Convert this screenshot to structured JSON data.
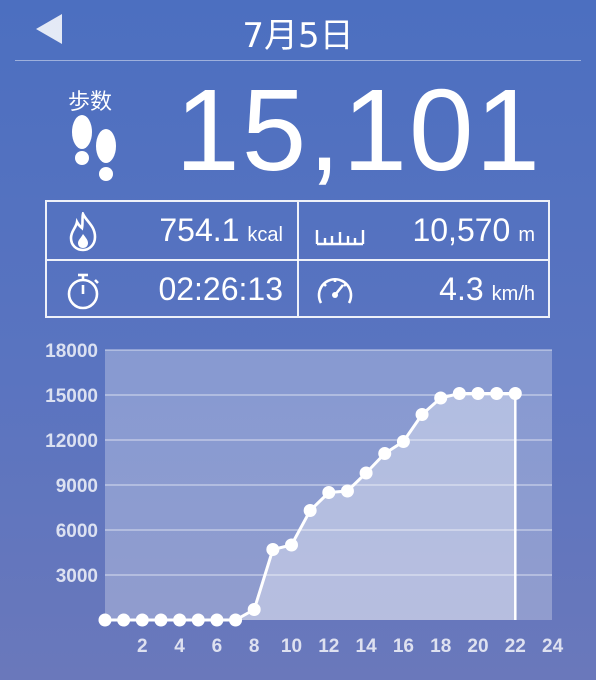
{
  "header": {
    "title": "7月5日",
    "back_icon": "back-arrow-icon"
  },
  "summary": {
    "steps_label": "歩数",
    "steps_icon": "footprints-icon",
    "steps_value": "15,101"
  },
  "stats": [
    {
      "id": "calories",
      "icon": "flame-icon",
      "value": "754.1",
      "unit": "kcal"
    },
    {
      "id": "distance",
      "icon": "ruler-icon",
      "value": "10,570",
      "unit": "m"
    },
    {
      "id": "time",
      "icon": "stopwatch-icon",
      "value": "02:26:13",
      "unit": ""
    },
    {
      "id": "speed",
      "icon": "speedometer-icon",
      "value": "4.3",
      "unit": "km/h"
    }
  ],
  "chart_data": {
    "type": "area",
    "x": [
      0,
      1,
      2,
      3,
      4,
      5,
      6,
      7,
      8,
      9,
      10,
      11,
      12,
      13,
      14,
      15,
      16,
      17,
      18,
      19,
      20,
      21,
      22
    ],
    "values": [
      0,
      0,
      0,
      0,
      0,
      0,
      0,
      0,
      700,
      4700,
      5000,
      7300,
      8500,
      8600,
      9800,
      11100,
      11900,
      13700,
      14800,
      15100,
      15100,
      15100,
      15100
    ],
    "xticks": [
      2,
      4,
      6,
      8,
      10,
      12,
      14,
      16,
      18,
      20,
      22,
      24
    ],
    "yticks": [
      3000,
      6000,
      9000,
      12000,
      15000,
      18000
    ],
    "ylim": [
      0,
      18000
    ],
    "xlim": [
      0,
      24
    ],
    "grid": true,
    "xlabel": "",
    "ylabel": "",
    "title": ""
  }
}
